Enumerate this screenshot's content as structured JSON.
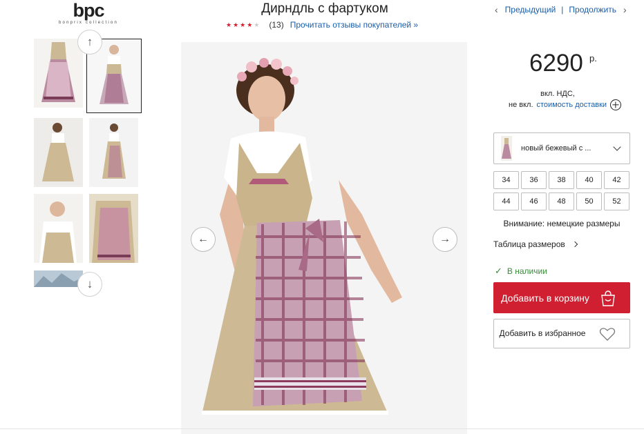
{
  "brand": {
    "logo_text": "bpc",
    "logo_subtext": "bonprix collection"
  },
  "product": {
    "title": "Дирндль с фартуком",
    "rating": 4,
    "rating_max": 5,
    "review_count": "(13)",
    "reviews_link": "Прочитать отзывы покупателей »"
  },
  "nav": {
    "prev_label": "Предыдущий",
    "separator": "|",
    "next_label": "Продолжить"
  },
  "gallery": {
    "thumbnails": [
      {
        "label": "thumbnail-1",
        "selected": false
      },
      {
        "label": "thumbnail-2",
        "selected": true
      },
      {
        "label": "thumbnail-3",
        "selected": false
      },
      {
        "label": "thumbnail-4",
        "selected": false
      },
      {
        "label": "thumbnail-5",
        "selected": false
      },
      {
        "label": "thumbnail-6",
        "selected": false
      },
      {
        "label": "thumbnail-7",
        "selected": false
      }
    ],
    "scroll_up_icon": "arrow-up-icon",
    "scroll_down_icon": "arrow-down-icon",
    "prev_icon": "arrow-left-icon",
    "next_icon": "arrow-right-icon"
  },
  "pricing": {
    "price": "6290",
    "currency": "р.",
    "vat_text": "вкл. НДС,",
    "delivery_prefix": "не вкл.",
    "delivery_link": "стоимость доставки"
  },
  "options": {
    "color_selected": "новый бежевый с ...",
    "sizes": [
      "34",
      "36",
      "38",
      "40",
      "42",
      "44",
      "46",
      "48",
      "50",
      "52"
    ],
    "size_note": "Внимание: немецкие размеры",
    "size_table_label": "Таблица размеров"
  },
  "availability": {
    "status": "В наличии"
  },
  "actions": {
    "add_to_cart": "Добавить в корзину",
    "add_to_favorites": "Добавить в избранное"
  },
  "colors": {
    "accent": "#d01f30",
    "link": "#1a5ea8",
    "in_stock": "#3a8a3a"
  }
}
